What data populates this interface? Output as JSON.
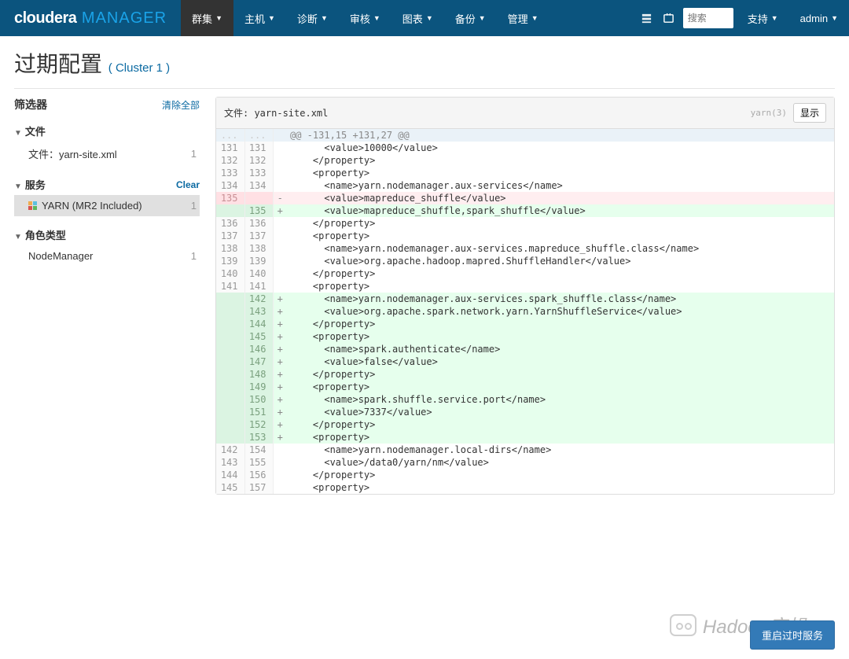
{
  "brand": {
    "left": "cloudera",
    "right": " MANAGER"
  },
  "nav": {
    "items": [
      "群集",
      "主机",
      "诊断",
      "审核",
      "图表",
      "备份",
      "管理"
    ],
    "search_placeholder": "搜索",
    "support": "支持",
    "admin": "admin"
  },
  "page": {
    "title": "过期配置",
    "cluster": "( Cluster 1 )"
  },
  "sidebar": {
    "filter_label": "筛选器",
    "clear_all": "清除全部",
    "sections": {
      "file": {
        "label": "文件",
        "clear": "",
        "items": [
          {
            "label": "文件：yarn-site.xml",
            "count": "1"
          }
        ]
      },
      "service": {
        "label": "服务",
        "clear": "Clear",
        "items": [
          {
            "label": "YARN (MR2 Included)",
            "count": "1"
          }
        ]
      },
      "role": {
        "label": "角色类型",
        "clear": "",
        "items": [
          {
            "label": "NodeManager",
            "count": "1"
          }
        ]
      }
    }
  },
  "file": {
    "prefix": "文件: ",
    "name": "yarn-site.xml",
    "badge": "yarn(3)",
    "show": "显示"
  },
  "diff": [
    {
      "t": "hunk",
      "a": "...",
      "b": "...",
      "m": "",
      "c": "@@ -131,15 +131,27 @@"
    },
    {
      "t": "ctx",
      "a": "131",
      "b": "131",
      "m": "",
      "c": "      <value>10000</value>"
    },
    {
      "t": "ctx",
      "a": "132",
      "b": "132",
      "m": "",
      "c": "    </property>"
    },
    {
      "t": "ctx",
      "a": "133",
      "b": "133",
      "m": "",
      "c": "    <property>"
    },
    {
      "t": "ctx",
      "a": "134",
      "b": "134",
      "m": "",
      "c": "      <name>yarn.nodemanager.aux-services</name>"
    },
    {
      "t": "del",
      "a": "135",
      "b": "",
      "m": "-",
      "c": "      <value>mapreduce_shuffle</value>"
    },
    {
      "t": "add",
      "a": "",
      "b": "135",
      "m": "+",
      "c": "      <value>mapreduce_shuffle,spark_shuffle</value>"
    },
    {
      "t": "ctx",
      "a": "136",
      "b": "136",
      "m": "",
      "c": "    </property>"
    },
    {
      "t": "ctx",
      "a": "137",
      "b": "137",
      "m": "",
      "c": "    <property>"
    },
    {
      "t": "ctx",
      "a": "138",
      "b": "138",
      "m": "",
      "c": "      <name>yarn.nodemanager.aux-services.mapreduce_shuffle.class</name>"
    },
    {
      "t": "ctx",
      "a": "139",
      "b": "139",
      "m": "",
      "c": "      <value>org.apache.hadoop.mapred.ShuffleHandler</value>"
    },
    {
      "t": "ctx",
      "a": "140",
      "b": "140",
      "m": "",
      "c": "    </property>"
    },
    {
      "t": "ctx",
      "a": "141",
      "b": "141",
      "m": "",
      "c": "    <property>"
    },
    {
      "t": "add",
      "a": "",
      "b": "142",
      "m": "+",
      "c": "      <name>yarn.nodemanager.aux-services.spark_shuffle.class</name>"
    },
    {
      "t": "add",
      "a": "",
      "b": "143",
      "m": "+",
      "c": "      <value>org.apache.spark.network.yarn.YarnShuffleService</value>"
    },
    {
      "t": "add",
      "a": "",
      "b": "144",
      "m": "+",
      "c": "    </property>"
    },
    {
      "t": "add",
      "a": "",
      "b": "145",
      "m": "+",
      "c": "    <property>"
    },
    {
      "t": "add",
      "a": "",
      "b": "146",
      "m": "+",
      "c": "      <name>spark.authenticate</name>"
    },
    {
      "t": "add",
      "a": "",
      "b": "147",
      "m": "+",
      "c": "      <value>false</value>"
    },
    {
      "t": "add",
      "a": "",
      "b": "148",
      "m": "+",
      "c": "    </property>"
    },
    {
      "t": "add",
      "a": "",
      "b": "149",
      "m": "+",
      "c": "    <property>"
    },
    {
      "t": "add",
      "a": "",
      "b": "150",
      "m": "+",
      "c": "      <name>spark.shuffle.service.port</name>"
    },
    {
      "t": "add",
      "a": "",
      "b": "151",
      "m": "+",
      "c": "      <value>7337</value>"
    },
    {
      "t": "add",
      "a": "",
      "b": "152",
      "m": "+",
      "c": "    </property>"
    },
    {
      "t": "add",
      "a": "",
      "b": "153",
      "m": "+",
      "c": "    <property>"
    },
    {
      "t": "ctx",
      "a": "142",
      "b": "154",
      "m": "",
      "c": "      <name>yarn.nodemanager.local-dirs</name>"
    },
    {
      "t": "ctx",
      "a": "143",
      "b": "155",
      "m": "",
      "c": "      <value>/data0/yarn/nm</value>"
    },
    {
      "t": "ctx",
      "a": "144",
      "b": "156",
      "m": "",
      "c": "    </property>"
    },
    {
      "t": "ctx",
      "a": "145",
      "b": "157",
      "m": "",
      "c": "    <property>"
    }
  ],
  "footer": {
    "restart": "重启过时服务"
  },
  "watermark": "Hadoop实操"
}
